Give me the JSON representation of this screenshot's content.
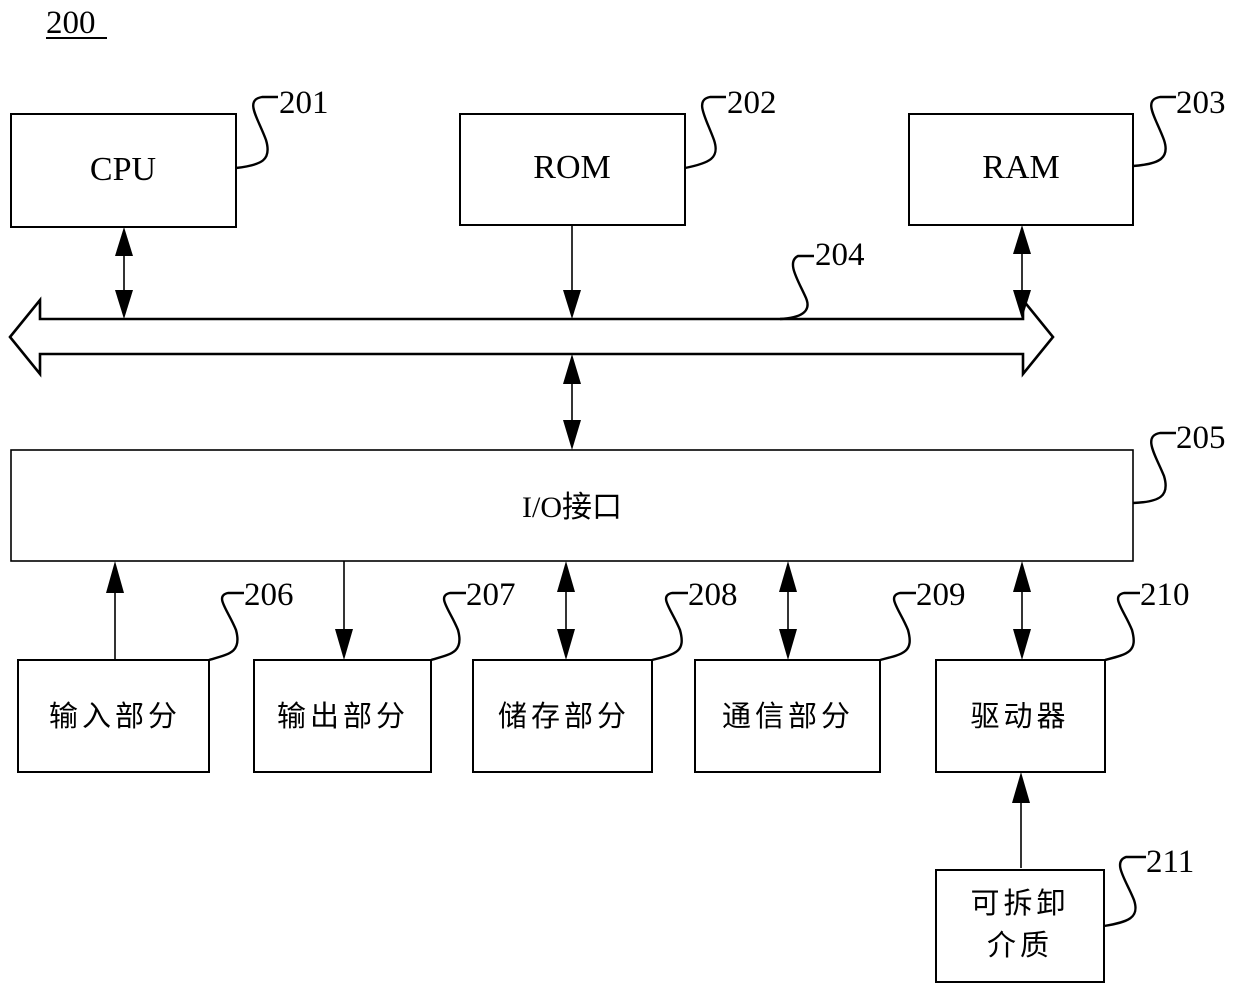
{
  "figure": {
    "number": "200"
  },
  "components": {
    "cpu": {
      "label": "CPU",
      "ref": "201"
    },
    "rom": {
      "label": "ROM",
      "ref": "202"
    },
    "ram": {
      "label": "RAM",
      "ref": "203"
    },
    "bus": {
      "ref": "204"
    },
    "io_interface": {
      "label": "I/O接口",
      "ref": "205"
    },
    "input_part": {
      "label": "输入部分",
      "ref": "206"
    },
    "output_part": {
      "label": "输出部分",
      "ref": "207"
    },
    "storage_part": {
      "label": "储存部分",
      "ref": "208"
    },
    "communication_part": {
      "label": "通信部分",
      "ref": "209"
    },
    "driver": {
      "label": "驱动器",
      "ref": "210"
    },
    "removable_media": {
      "label_line1": "可拆卸",
      "label_line2": "介质",
      "ref": "211"
    }
  },
  "connections": [
    {
      "from": "cpu",
      "to": "bus",
      "direction": "bidirectional"
    },
    {
      "from": "rom",
      "to": "bus",
      "direction": "one-way"
    },
    {
      "from": "ram",
      "to": "bus",
      "direction": "bidirectional"
    },
    {
      "from": "bus",
      "to": "io_interface",
      "direction": "bidirectional"
    },
    {
      "from": "input_part",
      "to": "io_interface",
      "direction": "one-way"
    },
    {
      "from": "io_interface",
      "to": "output_part",
      "direction": "one-way"
    },
    {
      "from": "io_interface",
      "to": "storage_part",
      "direction": "bidirectional"
    },
    {
      "from": "io_interface",
      "to": "communication_part",
      "direction": "bidirectional"
    },
    {
      "from": "io_interface",
      "to": "driver",
      "direction": "bidirectional"
    },
    {
      "from": "removable_media",
      "to": "driver",
      "direction": "one-way"
    }
  ]
}
